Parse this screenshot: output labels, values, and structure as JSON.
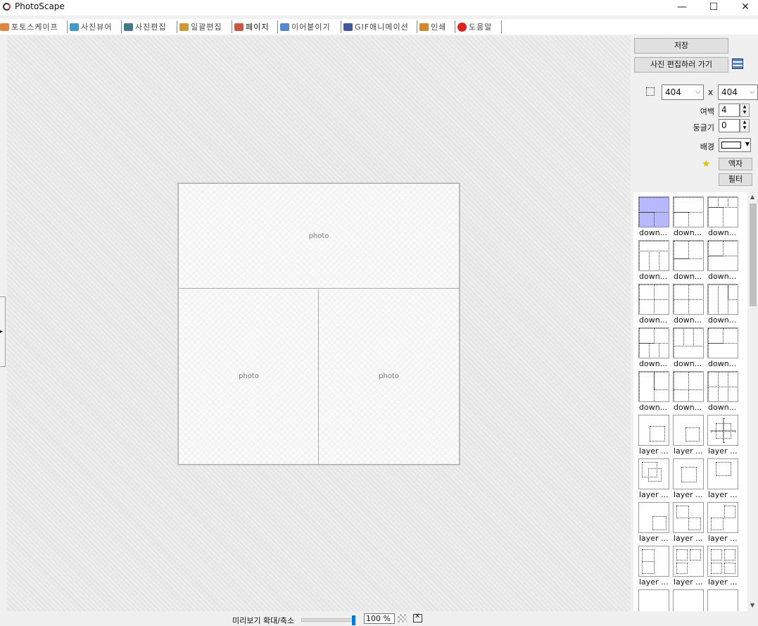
{
  "window": {
    "title": "PhotoScape",
    "minimize": "—",
    "maximize": "☐",
    "close": "✕"
  },
  "tabs": [
    {
      "label": "포토스케이프",
      "icon_color": "#d84"
    },
    {
      "label": "사진뷰어",
      "icon_color": "#49c"
    },
    {
      "label": "사진편집",
      "icon_color": "#478"
    },
    {
      "label": "일괄편집",
      "icon_color": "#c93"
    },
    {
      "label": "페이지",
      "icon_color": "#c54"
    },
    {
      "label": "이어붙이기",
      "icon_color": "#58c"
    },
    {
      "label": "GIF애니메이션",
      "icon_color": "#459"
    },
    {
      "label": "인쇄",
      "icon_color": "#c83"
    },
    {
      "label": "도움말",
      "icon_color": "#d22"
    }
  ],
  "active_tab": "페이지",
  "canvas": {
    "cells": [
      "photo",
      "photo",
      "photo"
    ]
  },
  "right_panel": {
    "save_label": "저장",
    "goto_editor_label": "사진 편집하러 가기",
    "width_value": "404",
    "times": "x",
    "height_value": "404",
    "margin_label": "여백",
    "margin_value": "4",
    "round_label": "둥글기",
    "round_value": "0",
    "background_label": "배경",
    "background_color": "#ffffff",
    "frame_label": "액자",
    "filter_label": "필터"
  },
  "layouts": [
    "down...",
    "down...",
    "down...",
    "down...",
    "down...",
    "down...",
    "down...",
    "down...",
    "down...",
    "down...",
    "down...",
    "down...",
    "down...",
    "down...",
    "down...",
    "layer ...",
    "layer ...",
    "layer ...",
    "layer ...",
    "layer ...",
    "layer ...",
    "layer ...",
    "layer ...",
    "layer ...",
    "layer ...",
    "layer ...",
    "layer ..."
  ],
  "bottom": {
    "zoom_label": "미리보기 확대/축소",
    "zoom_value": "100 %",
    "zoom_level_percent": 100
  },
  "colors": {
    "accent": "#0078d7",
    "selected_layout": "#b8b8ff"
  }
}
